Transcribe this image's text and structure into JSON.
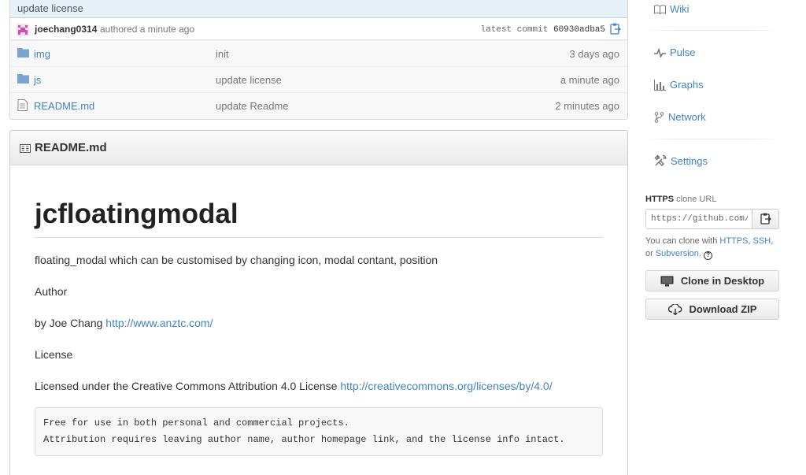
{
  "commit": {
    "message": "update license",
    "author": "joechang0314",
    "authored_text": "authored a minute ago",
    "latest_label": "latest commit",
    "sha": "60930adba5"
  },
  "files": [
    {
      "type": "folder",
      "name": "img",
      "message": "init",
      "age": "3 days ago"
    },
    {
      "type": "folder",
      "name": "js",
      "message": "update license",
      "age": "a minute ago"
    },
    {
      "type": "file",
      "name": "README.md",
      "message": "update Readme",
      "age": "2 minutes ago"
    }
  ],
  "readme": {
    "header": "README.md",
    "title": "jcfloatingmodal",
    "description": "floating_modal which can be customised by changing icon, modal contant, position",
    "author_heading": "Author",
    "author_prefix": "by Joe Chang ",
    "author_link": "http://www.anztc.com/",
    "license_heading": "License",
    "license_prefix": "Licensed under the Creative Commons Attribution 4.0 License ",
    "license_link": "http://creativecommons.org/licenses/by/4.0/",
    "code_block": "Free for use in both personal and commercial projects.\nAttribution requires leaving author name, author homepage link, and the license info intact."
  },
  "sidebar": {
    "nav": [
      {
        "label": "Wiki",
        "icon": "book-icon"
      },
      {
        "label": "Pulse",
        "icon": "pulse-icon"
      },
      {
        "label": "Graphs",
        "icon": "graph-icon"
      },
      {
        "label": "Network",
        "icon": "network-icon"
      },
      {
        "label": "Settings",
        "icon": "tools-icon"
      }
    ],
    "clone": {
      "protocol": "HTTPS",
      "label_suffix": "clone URL",
      "url_value": "https://github.com/",
      "help_prefix": "You can clone with ",
      "https_link": "HTTPS",
      "ssh_link": "SSH",
      "separator": ",",
      "or_text": "or",
      "subversion_link": "Subversion",
      "period": ".",
      "help_icon": "?"
    },
    "clone_desktop_label": "Clone in Desktop",
    "download_zip_label": "Download ZIP"
  },
  "colors": {
    "link": "#4183c4",
    "commit_bar": "#e6f1f6",
    "folder": "#7aa3d4"
  }
}
